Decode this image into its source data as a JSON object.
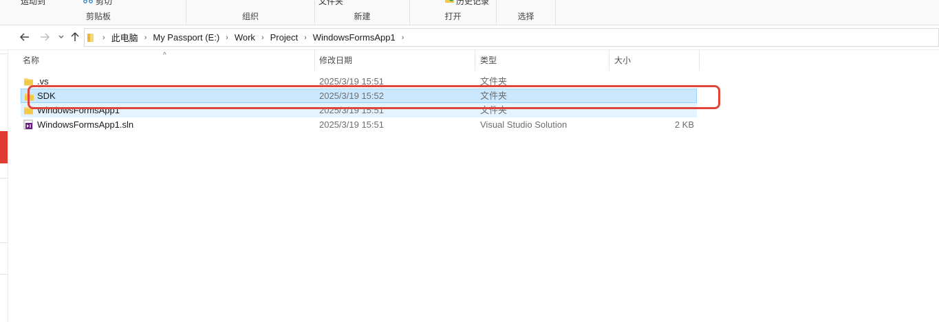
{
  "ribbon": {
    "cut_label": "剪切",
    "top_partial_left": "运动到",
    "top_partial_mid": "文件夹",
    "top_partial_right": "历史记录",
    "groups": [
      {
        "label": "剪贴板"
      },
      {
        "label": "组织"
      },
      {
        "label": "新建"
      },
      {
        "label": "打开"
      },
      {
        "label": "选择"
      }
    ]
  },
  "nav": {
    "back_icon": "arrow-left-icon",
    "forward_icon": "arrow-right-icon",
    "recent_icon": "chevron-down-icon",
    "up_icon": "arrow-up-icon"
  },
  "breadcrumb": {
    "items": [
      "此电脑",
      "My Passport (E:)",
      "Work",
      "Project",
      "WindowsFormsApp1"
    ]
  },
  "columns": {
    "name": "名称",
    "date": "修改日期",
    "type": "类型",
    "size": "大小"
  },
  "files": [
    {
      "name": ".vs",
      "date": "2025/3/19 15:51",
      "type": "文件夹",
      "size": "",
      "icon": "folder-icon"
    },
    {
      "name": "SDK",
      "date": "2025/3/19 15:52",
      "type": "文件夹",
      "size": "",
      "icon": "folder-icon"
    },
    {
      "name": "WindowsFormsApp1",
      "date": "2025/3/19 15:51",
      "type": "文件夹",
      "size": "",
      "icon": "folder-icon"
    },
    {
      "name": "WindowsFormsApp1.sln",
      "date": "2025/3/19 15:51",
      "type": "Visual Studio Solution",
      "size": "2 KB",
      "icon": "vs-solution-icon"
    }
  ],
  "colors": {
    "selection_bg": "#cce8ff",
    "selection_border": "#99d1ff",
    "annotation": "#e0453a",
    "folder": "#f8d775"
  }
}
